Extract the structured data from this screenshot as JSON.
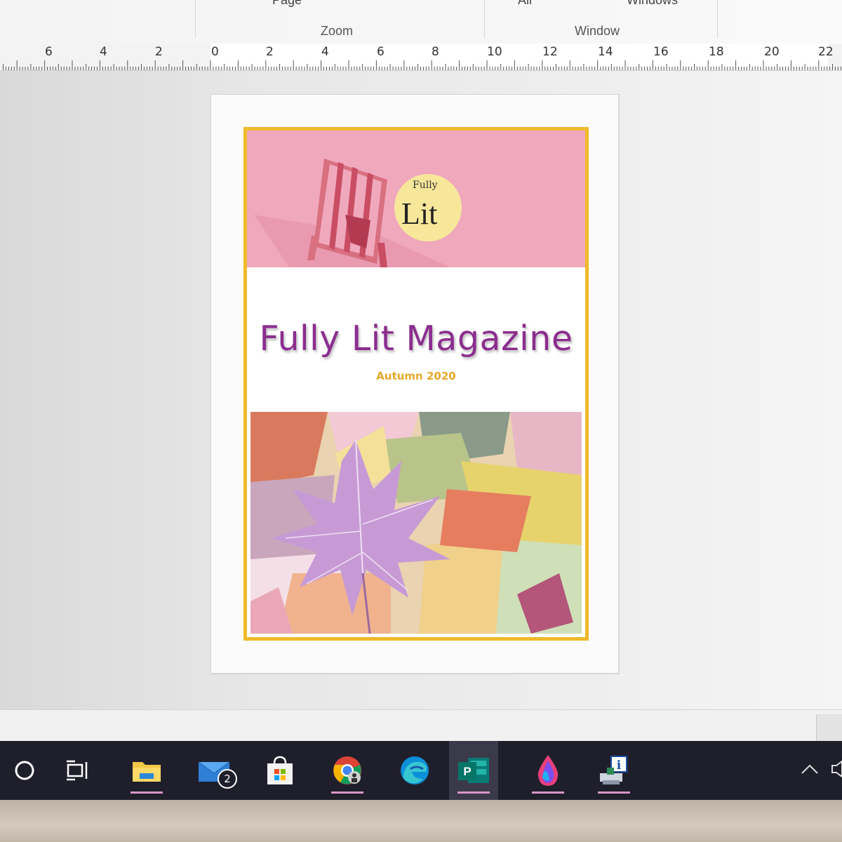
{
  "ribbon": {
    "partial_labels": [
      "Page",
      "All",
      "Windows"
    ],
    "groups": [
      "Zoom",
      "Window"
    ]
  },
  "ruler": {
    "numbers": [
      "6",
      "4",
      "2",
      "0",
      "2",
      "4",
      "6",
      "8",
      "10",
      "12",
      "14",
      "16",
      "18",
      "20",
      "22"
    ]
  },
  "cover": {
    "logo_small": "Fully",
    "logo_large": "Lit",
    "title": "Fully Lit Magazine",
    "subtitle": "Autumn 2020"
  },
  "colors": {
    "frame": "#f0b92a",
    "banner": "#f0a8bd",
    "title": "#8c2d8f",
    "subtitle": "#e4a82a",
    "taskbar": "#1f1f2c"
  },
  "taskbar": {
    "items": [
      {
        "name": "search",
        "icon": "search-circle-icon"
      },
      {
        "name": "task-view",
        "icon": "task-view-icon"
      },
      {
        "name": "file-explorer",
        "icon": "folder-icon"
      },
      {
        "name": "mail",
        "icon": "mail-icon",
        "badge": "2"
      },
      {
        "name": "microsoft-store",
        "icon": "store-bag-icon"
      },
      {
        "name": "chrome",
        "icon": "chrome-icon"
      },
      {
        "name": "edge",
        "icon": "edge-icon"
      },
      {
        "name": "publisher",
        "icon": "publisher-icon",
        "letter": "P"
      },
      {
        "name": "paint-3d",
        "icon": "paint-drop-icon"
      },
      {
        "name": "info-app",
        "icon": "info-printer-icon",
        "letter": "i"
      }
    ],
    "tray": [
      {
        "name": "show-hidden",
        "icon": "chevron-up-icon"
      },
      {
        "name": "volume",
        "icon": "speaker-icon"
      }
    ]
  }
}
